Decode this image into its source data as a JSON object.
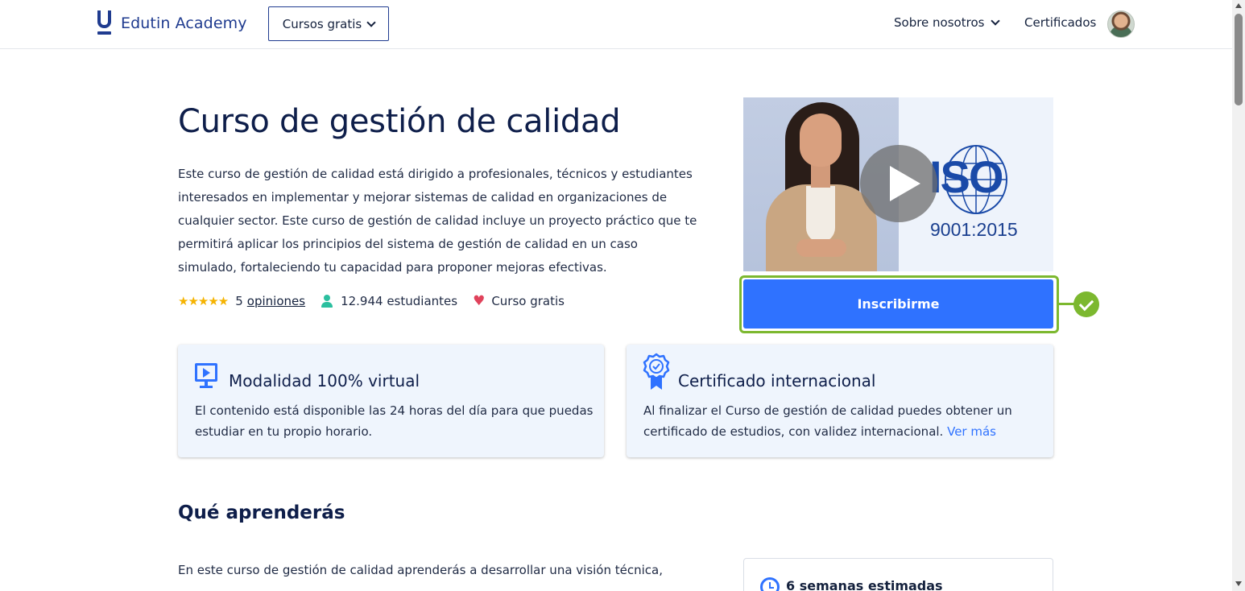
{
  "header": {
    "brand": "Edutin Academy",
    "courses_dropdown": "Cursos gratis",
    "about": "Sobre nosotros",
    "certificates": "Certificados"
  },
  "hero": {
    "title": "Curso de gestión de calidad",
    "description": "Este curso de gestión de calidad está dirigido a profesionales, técnicos y estudiantes interesados en implementar y mejorar sistemas de calidad en organizaciones de cualquier sector. Este curso de gestión de calidad incluye un proyecto práctico que te permitirá aplicar los principios del sistema de gestión de calidad en un caso simulado, fortaleciendo tu capacidad para proponer mejoras efectivas.",
    "rating_stars": 5,
    "stars_glyphs": "★★★★★",
    "reviews_count": "5",
    "reviews_link": "opiniones",
    "students": "12.944 estudiantes",
    "price_label": "Curso gratis"
  },
  "video": {
    "iso_text": "ISO",
    "iso_subtext": "9001:2015"
  },
  "enroll": {
    "button_label": "Inscribirme"
  },
  "features": [
    {
      "title": "Modalidad 100% virtual",
      "text": "El contenido está disponible las 24 horas del día para que puedas estudiar en tu propio horario."
    },
    {
      "title": "Certificado internacional",
      "text": "Al finalizar el Curso de gestión de calidad puedes obtener un certificado de estudios, con validez internacional.",
      "link": "Ver más"
    }
  ],
  "learn": {
    "title": "Qué aprenderás",
    "text": "En este curso de gestión de calidad aprenderás a desarrollar una visión técnica,",
    "duration": "6 semanas estimadas"
  },
  "colors": {
    "accent": "#2f72ff",
    "brand": "#1f3b8f",
    "highlight": "#7cb82f",
    "card_bg": "#eff5fd"
  }
}
